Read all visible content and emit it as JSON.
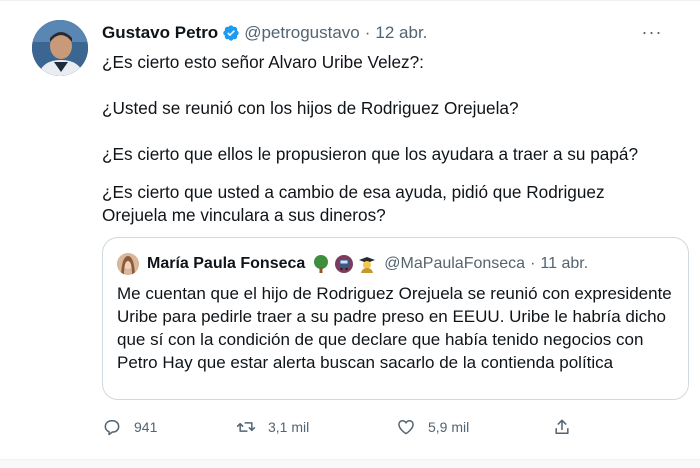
{
  "tweet": {
    "author_name": "Gustavo Petro",
    "handle": "@petrogustavo",
    "separator": "·",
    "date": "12 abr.",
    "more_label": "···",
    "lines": [
      "¿Es cierto esto señor Alvaro Uribe Velez?:",
      "¿Usted se reunió con los hijos de Rodriguez Orejuela?",
      "¿Es cierto que ellos le propusieron que los ayudara a traer a su papá?",
      "¿Es cierto que usted a cambio de esa ayuda, pidió que Rodriguez Orejuela me vinculara a sus dineros?"
    ]
  },
  "quoted": {
    "author_name": "María Paula Fonseca",
    "emojis": [
      "tree-icon",
      "train-icon",
      "graduate-icon"
    ],
    "handle": "@MaPaulaFonseca",
    "separator": "·",
    "date": "11 abr.",
    "text": "Me cuentan que el hijo de Rodriguez Orejuela se reunió con expresidente Uribe para pedirle traer a su padre preso en EEUU. Uribe le habría dicho que sí con la condición de que declare que había tenido negocios con Petro Hay que estar alerta buscan sacarlo de la contienda política"
  },
  "actions": {
    "replies": "941",
    "retweets": "3,1 mil",
    "likes": "5,9 mil"
  },
  "colors": {
    "verified": "#1d9bf0",
    "muted": "#536471",
    "text": "#0f1419",
    "border": "#cfd9de"
  }
}
